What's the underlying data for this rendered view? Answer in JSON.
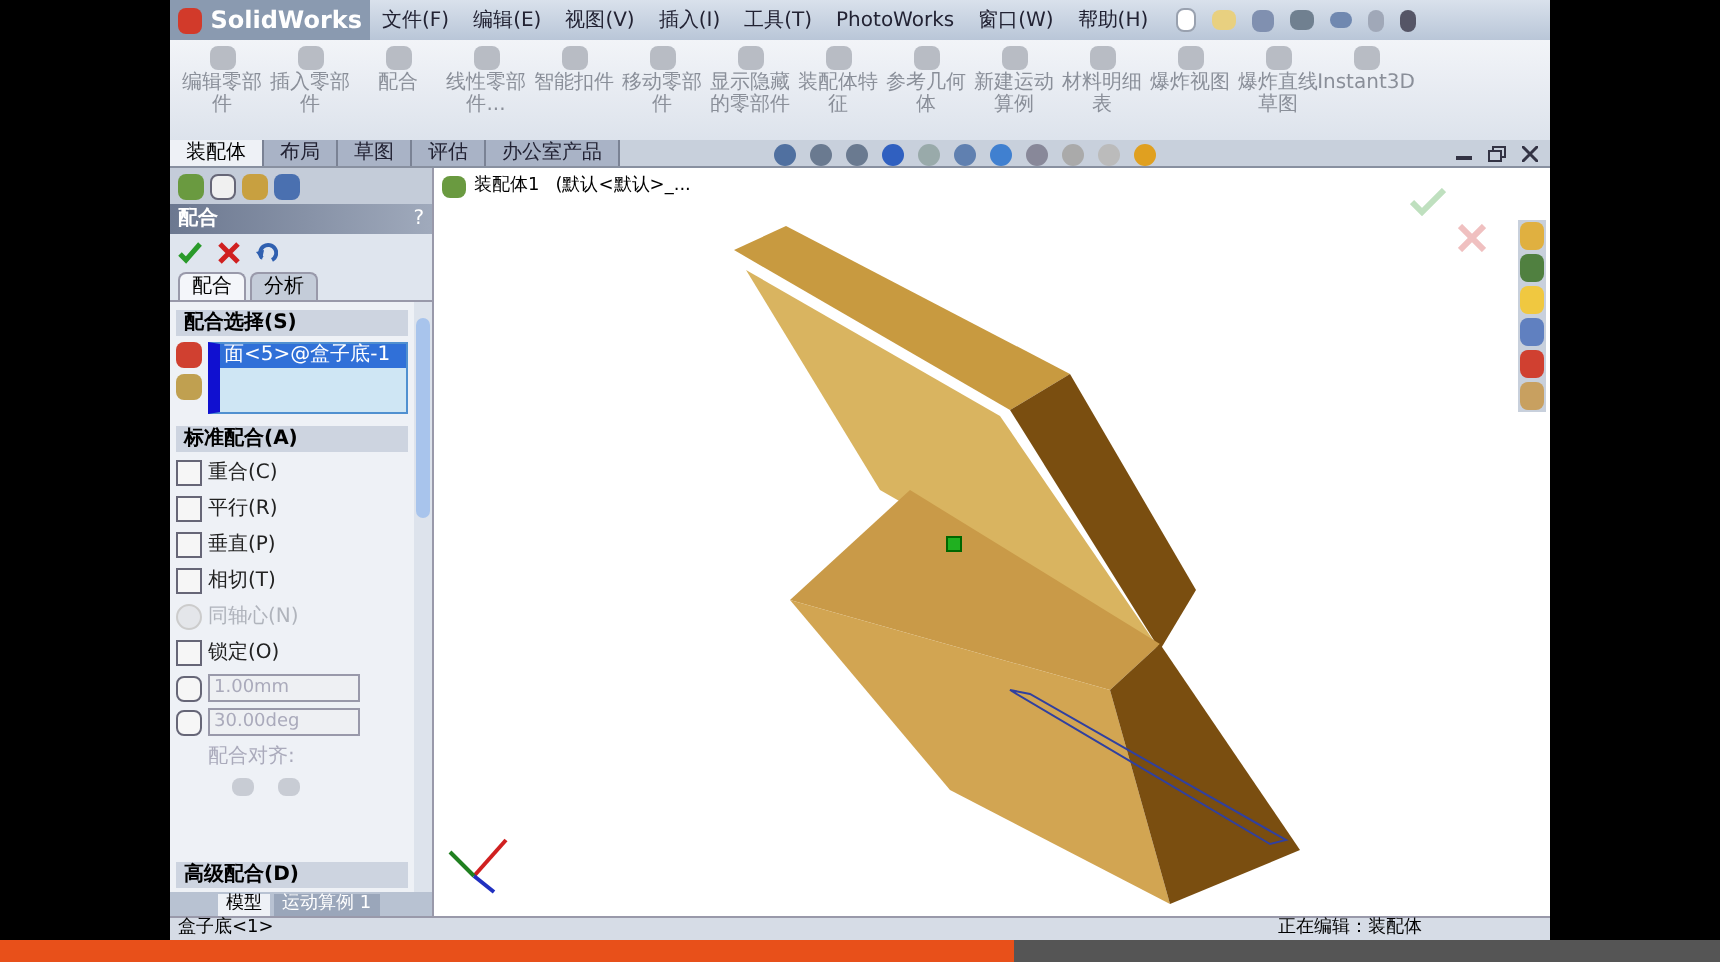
{
  "app": {
    "logo": "SolidWorks"
  },
  "menu": [
    "文件(F)",
    "编辑(E)",
    "视图(V)",
    "插入(I)",
    "工具(T)",
    "PhotoWorks",
    "窗口(W)",
    "帮助(H)"
  ],
  "command_buttons": [
    "编辑零部件",
    "插入零部件",
    "配合",
    "线性零部件...",
    "智能扣件",
    "移动零部件",
    "显示隐藏的零部件",
    "装配体特征",
    "参考几何体",
    "新建运动算例",
    "材料明细表",
    "爆炸视图",
    "爆炸直线草图",
    "Instant3D"
  ],
  "command_tabs": [
    {
      "label": "装配体",
      "selected": true
    },
    {
      "label": "布局",
      "selected": false
    },
    {
      "label": "草图",
      "selected": false
    },
    {
      "label": "评估",
      "selected": false
    },
    {
      "label": "办公室产品",
      "selected": false
    }
  ],
  "property_manager": {
    "title": "配合",
    "help": "?",
    "tabs": [
      {
        "label": "配合",
        "selected": true
      },
      {
        "label": "分析",
        "selected": false
      }
    ],
    "selection_section": {
      "title": "配合选择(S)",
      "items": [
        "面<5>@盒子底-1"
      ]
    },
    "standard_section": {
      "title": "标准配合(A)",
      "mates": [
        {
          "label": "重合(C)",
          "disabled": false
        },
        {
          "label": "平行(R)",
          "disabled": false
        },
        {
          "label": "垂直(P)",
          "disabled": false
        },
        {
          "label": "相切(T)",
          "disabled": false
        },
        {
          "label": "同轴心(N)",
          "disabled": true
        },
        {
          "label": "锁定(O)",
          "disabled": false
        }
      ],
      "fields": [
        {
          "value": "1.00mm",
          "disabled": true
        },
        {
          "value": "30.00deg",
          "disabled": true
        }
      ],
      "alignment_label": "配合对齐:"
    },
    "advanced_section": {
      "title": "高级配合(D)"
    }
  },
  "bottom_tabs": [
    {
      "label": "模型",
      "selected": false
    },
    {
      "label": "运动算例 1",
      "selected": true
    }
  ],
  "breadcrumb": {
    "name": "装配体1",
    "config": "(默认<默认>_..."
  },
  "status_bar": {
    "left": "盒子底<1>",
    "right": "正在编辑：装配体"
  },
  "video_player": {
    "level": 0.59
  }
}
